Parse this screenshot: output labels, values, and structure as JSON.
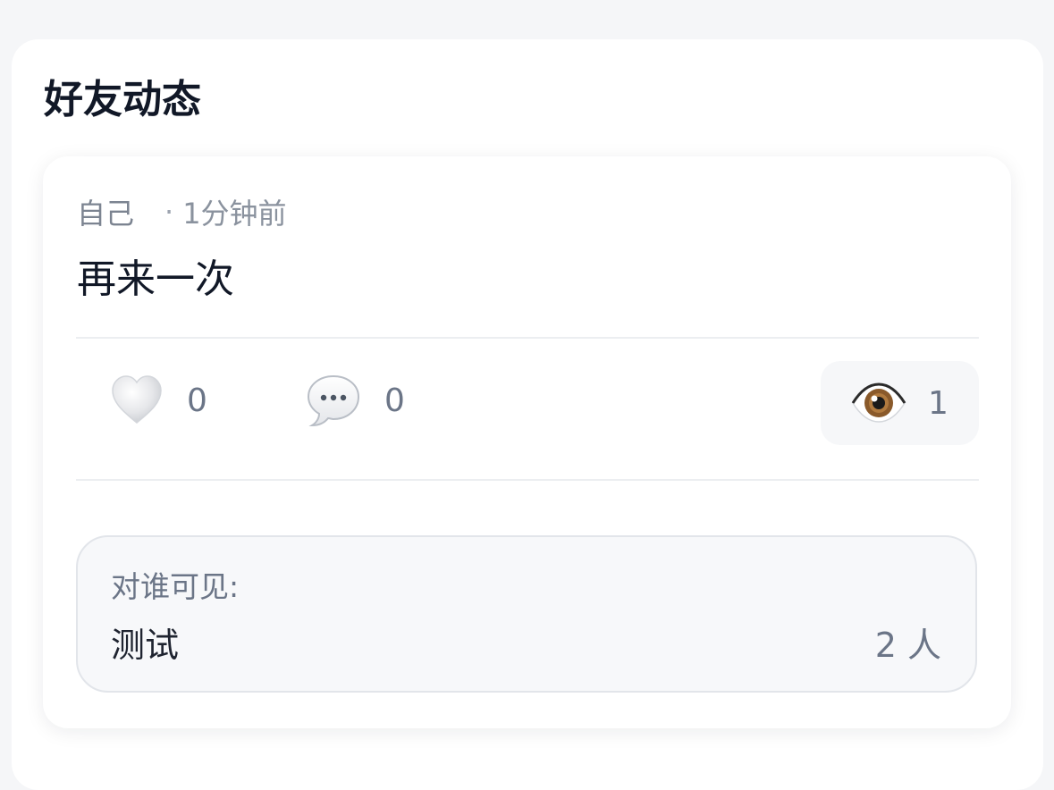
{
  "section": {
    "title": "好友动态"
  },
  "post": {
    "author": "自己",
    "separator": "·",
    "time": "1分钟前",
    "content": "再来一次",
    "actions": {
      "like": {
        "icon": "heart-icon",
        "count": "0"
      },
      "comment": {
        "icon": "speech-bubble-icon",
        "count": "0"
      },
      "views": {
        "icon": "eye-icon",
        "count": "1"
      }
    },
    "visibility": {
      "label": "对谁可见:",
      "group": "测试",
      "member_count": "2 人"
    }
  }
}
